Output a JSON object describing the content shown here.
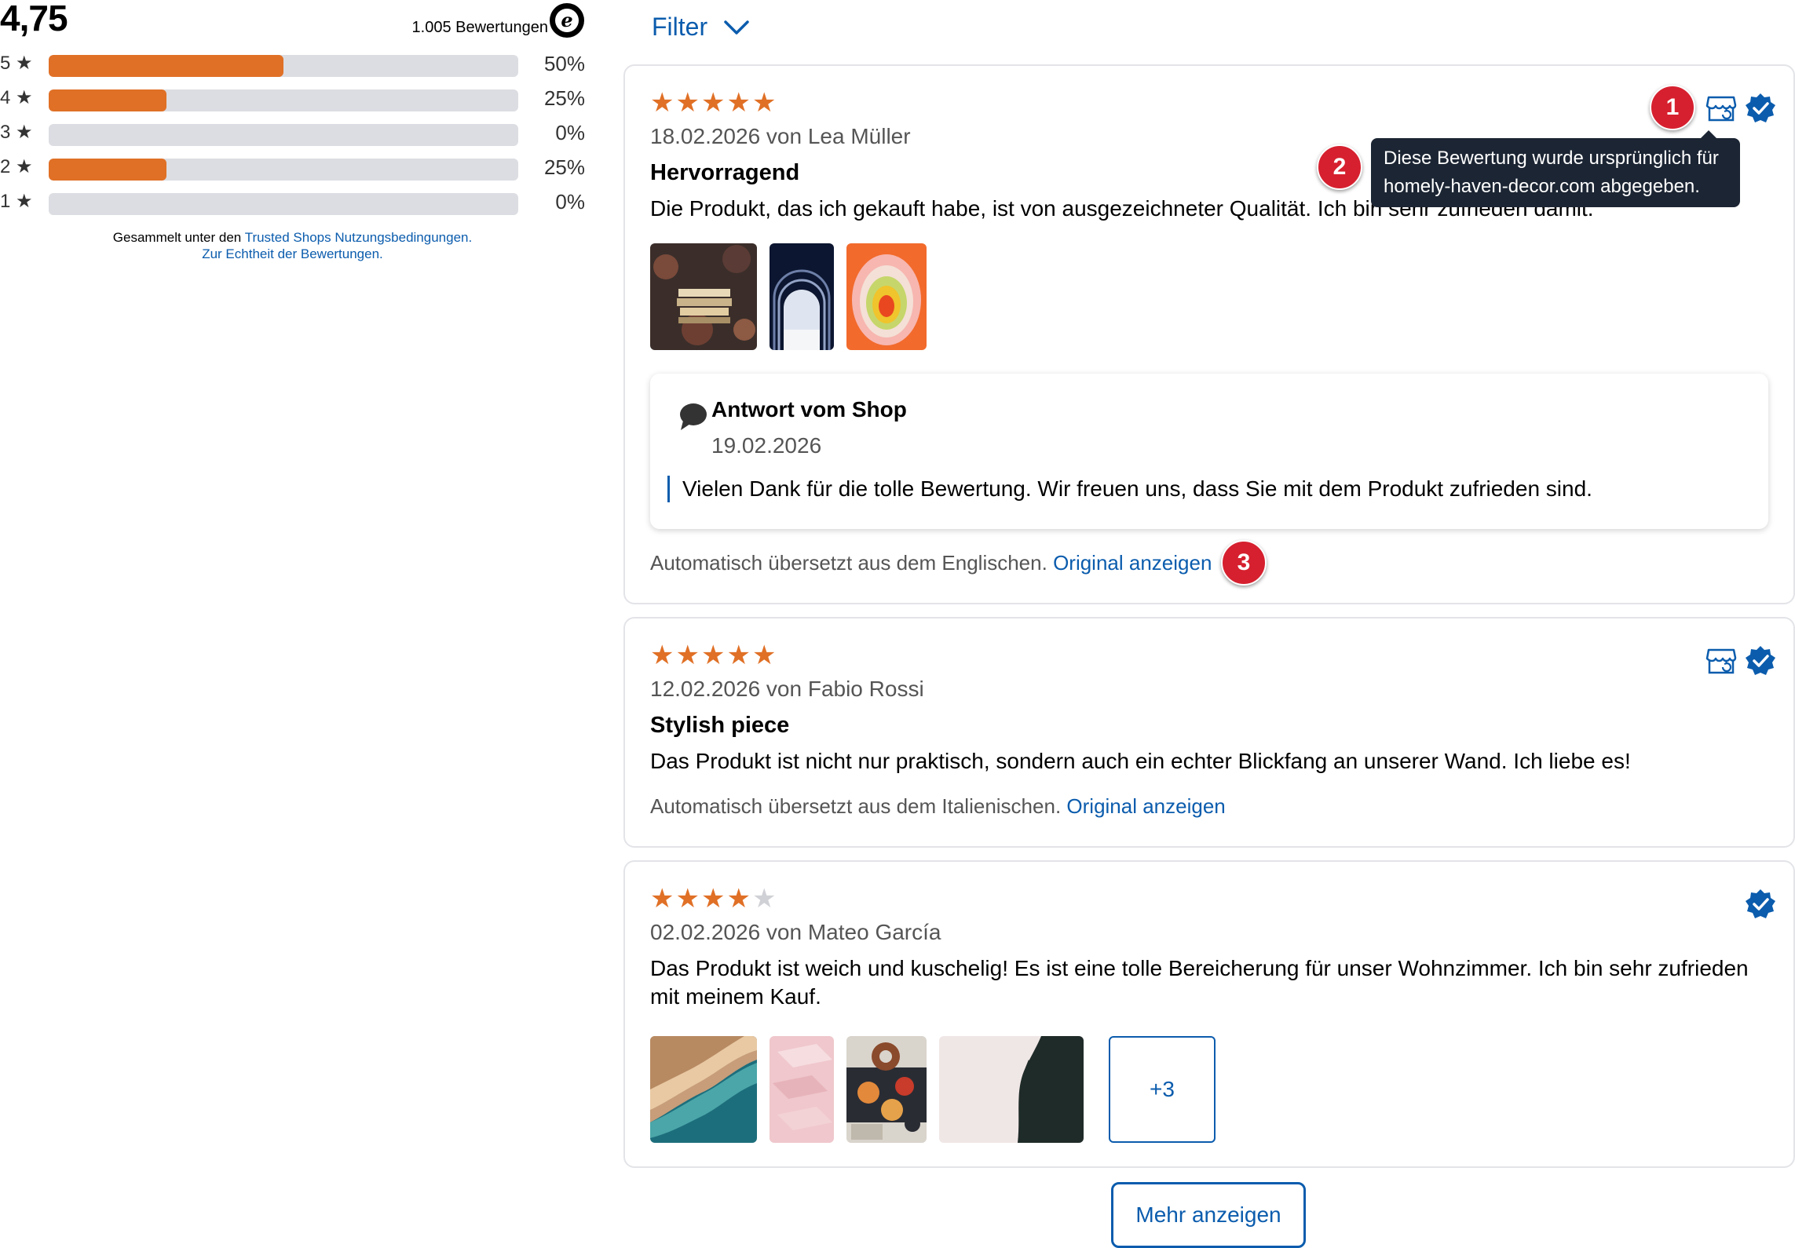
{
  "summary": {
    "score": "4,75",
    "total": "1.005 Bewertungen",
    "distribution": [
      {
        "label": "5 ★",
        "percent": "50%",
        "value": 50
      },
      {
        "label": "4 ★",
        "percent": "25%",
        "value": 25
      },
      {
        "label": "3 ★",
        "percent": "0%",
        "value": 0
      },
      {
        "label": "2 ★",
        "percent": "25%",
        "value": 25
      },
      {
        "label": "1 ★",
        "percent": "0%",
        "value": 0
      }
    ],
    "footnote_prefix": "Gesammelt unter den ",
    "footnote_link1": "Trusted Shops Nutzungsbedingungen.",
    "footnote_link2": "Zur Echtheit der Bewertungen."
  },
  "filter": {
    "label": "Filter"
  },
  "reviews": [
    {
      "rating": 5,
      "meta": "18.02.2026 von Lea Müller",
      "title": "Hervorragend",
      "body": "Die Produkt, das ich gekauft habe, ist von ausgezeichneter Qualität. Ich bin sehr zufrieden damit.",
      "reply": {
        "title": "Antwort vom Shop",
        "date": "19.02.2026",
        "text": "Vielen Dank für die tolle Bewertung. Wir freuen uns, dass Sie mit dem Produkt zufrieden sind."
      },
      "translated_prefix": "Automatisch übersetzt aus dem Englischen.",
      "original_link": "Original anzeigen"
    },
    {
      "rating": 5,
      "meta": "12.02.2026 von Fabio Rossi",
      "title": "Stylish piece",
      "body": "Das Produkt ist nicht nur praktisch, sondern auch ein echter Blickfang an unserer Wand. Ich liebe es!",
      "translated_prefix": "Automatisch übersetzt aus dem Italienischen.",
      "original_link": "Original anzeigen"
    },
    {
      "rating": 4,
      "meta": "02.02.2026 von Mateo García",
      "body": "Das Produkt ist weich und kuschelig! Es ist eine tolle Bereicherung für unser Wohnzimmer. Ich bin sehr zufrieden mit meinem Kauf.",
      "more_images": "+3"
    }
  ],
  "tooltip": {
    "line1": "Diese Bewertung wurde ursprünglich für",
    "line2": "homely-haven-decor.com abgegeben."
  },
  "markers": [
    "1",
    "2",
    "3"
  ],
  "more_button": "Mehr anzeigen",
  "colors": {
    "accent": "#e07026",
    "link": "#0b5cad",
    "marker": "#d6202f",
    "tooltip_bg": "#1c2533"
  }
}
